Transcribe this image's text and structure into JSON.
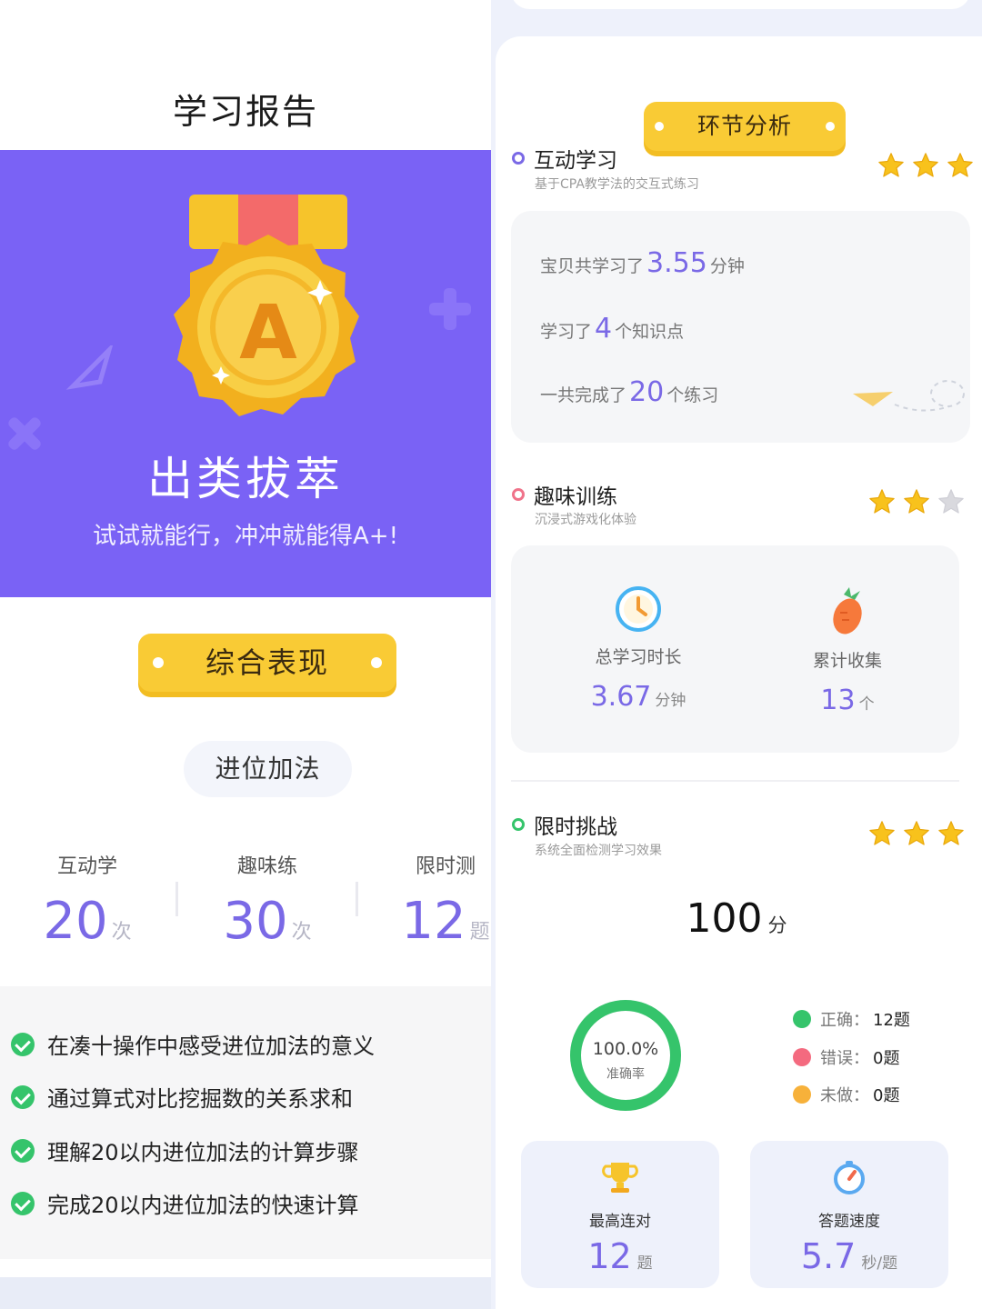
{
  "left": {
    "title": "学习报告",
    "hero": {
      "medal_letter": "A",
      "title": "出类拔萃",
      "subtitle": "试试就能行，冲冲就能得A+!"
    },
    "overall_label": "综合表现",
    "topic": "进位加法",
    "stats": [
      {
        "label": "互动学",
        "value": "20",
        "unit": "次"
      },
      {
        "label": "趣味练",
        "value": "30",
        "unit": "次"
      },
      {
        "label": "限时测",
        "value": "12",
        "unit": "题"
      }
    ],
    "goals": [
      "在凑十操作中感受进位加法的意义",
      "通过算式对比挖掘数的关系求和",
      "理解20以内进位加法的计算步骤",
      "完成20以内进位加法的快速计算"
    ]
  },
  "right": {
    "analysis_label": "环节分析",
    "interactive": {
      "title": "互动学习",
      "subtitle": "基于CPA教学法的交互式练习",
      "stars": 3,
      "lines": [
        {
          "pre": "宝贝共学习了",
          "value": "3.55",
          "post": "分钟"
        },
        {
          "pre": "学习了",
          "value": "4",
          "post": "个知识点"
        },
        {
          "pre": "一共完成了",
          "value": "20",
          "post": "个练习"
        }
      ]
    },
    "fun": {
      "title": "趣味训练",
      "subtitle": "沉浸式游戏化体验",
      "stars": 2,
      "tiles": [
        {
          "label": "总学习时长",
          "value": "3.67",
          "unit": "分钟"
        },
        {
          "label": "累计收集",
          "value": "13",
          "unit": "个"
        }
      ]
    },
    "challenge": {
      "title": "限时挑战",
      "subtitle": "系统全面检测学习效果",
      "stars": 3,
      "score": "100",
      "score_unit": "分",
      "accuracy": "100.0%",
      "accuracy_label": "准确率",
      "accuracy_fraction": 1.0,
      "legend": [
        {
          "label": "正确：",
          "value": "12题",
          "color": "#35c46b"
        },
        {
          "label": "错误：",
          "value": "0题",
          "color": "#f46a7f"
        },
        {
          "label": "未做：",
          "value": "0题",
          "color": "#f7b13a"
        }
      ],
      "cards": [
        {
          "label": "最高连对",
          "value": "12",
          "unit": "题"
        },
        {
          "label": "答题速度",
          "value": "5.7",
          "unit": "秒/题"
        }
      ]
    }
  },
  "colors": {
    "brand_purple": "#7a62f5",
    "accent_yellow": "#f9cb35",
    "success_green": "#35c46b"
  }
}
